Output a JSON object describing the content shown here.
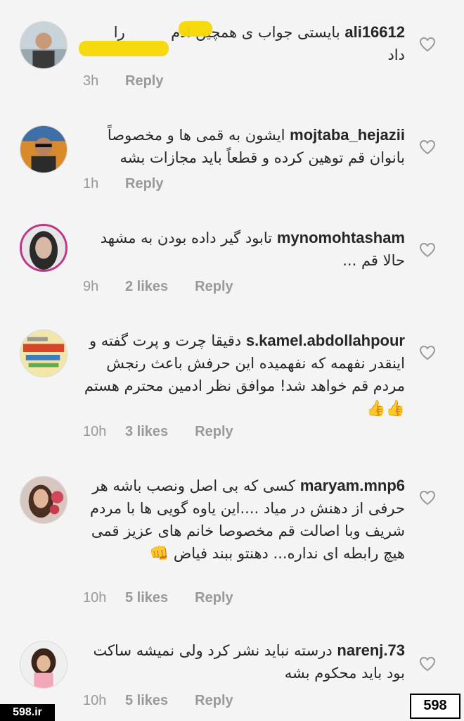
{
  "comments": [
    {
      "username": "ali16612",
      "text_line1": "بایستی جواب ی همچین ادم",
      "text_line1_tail": "را",
      "text_line2": "داد",
      "time": "3h",
      "likes": "",
      "reply": "Reply"
    },
    {
      "username": "mojtaba_hejazii",
      "text": "ایشون به قمی ها و مخصوصاً بانوان قم توهین کرده و قطعاً باید مجازات بشه",
      "time": "1h",
      "likes": "",
      "reply": "Reply"
    },
    {
      "username": "mynomohtasham",
      "text": "تابود  گیر داده بودن به مشهد حالا قم ...",
      "time": "9h",
      "likes": "2 likes",
      "reply": "Reply"
    },
    {
      "username": "s.kamel.abdollahpour",
      "text": "دقیقا چرت و پرت گفته و اینقدر نفهمه که نفهمیده این حرفش باعث رنجش مردم قم خواهد شد! موافق نظر ادمین محترم هستم",
      "emoji": "👍👍",
      "time": "10h",
      "likes": "3 likes",
      "reply": "Reply"
    },
    {
      "username": "maryam.mnp6",
      "text": "کسی که بی اصل ونصب باشه هر حرفی از دهنش در میاد ....این یاوه گویی ها با مردم شریف وبا اصالت قم مخصوصا خانم های عزیز قمی هیچ رابطه ای نداره... دهنتو ببند فیاض",
      "emoji": "👊",
      "time": "10h",
      "likes": "5 likes",
      "reply": "Reply"
    },
    {
      "username": "narenj.73",
      "text": "درسته نباید نشر کرد ولی نمیشه ساکت بود باید محکوم بشه",
      "time": "10h",
      "likes": "5 likes",
      "reply": "Reply"
    }
  ],
  "watermark": {
    "left": "598.ir",
    "right": "598"
  },
  "colors": {
    "background": "#f4f4f4",
    "meta_gray": "#999999",
    "highlight": "#f5d800",
    "story_ring": "#c13584"
  }
}
